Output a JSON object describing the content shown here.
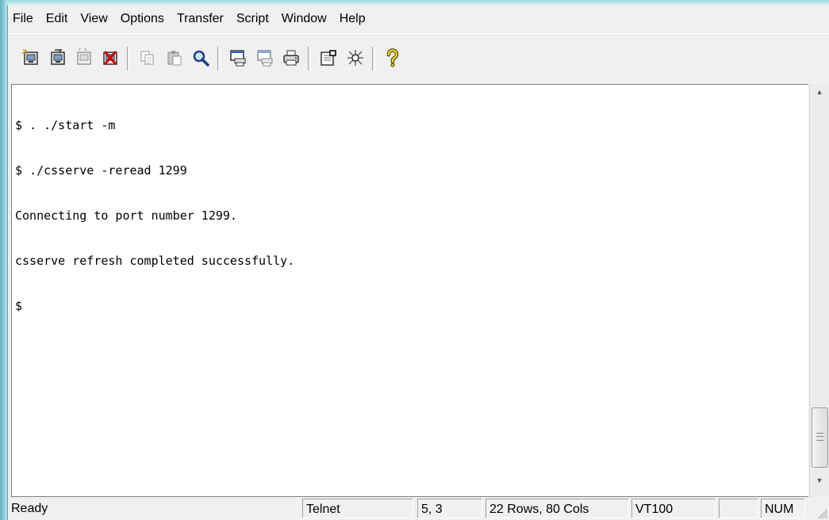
{
  "menu": {
    "items": [
      "File",
      "Edit",
      "View",
      "Options",
      "Transfer",
      "Script",
      "Window",
      "Help"
    ]
  },
  "toolbar": {
    "buttons": [
      "connect-icon",
      "quick-connect-icon",
      "reconnect-icon",
      "disconnect-icon",
      "copy-icon",
      "paste-icon",
      "find-icon",
      "print-screen-icon",
      "print-selection-icon",
      "print-icon",
      "session-options-icon",
      "keymap-icon",
      "help-icon"
    ]
  },
  "terminal": {
    "lines": [
      "$ . ./start -m",
      "$ ./csserve -reread 1299",
      "Connecting to port number 1299.",
      "csserve refresh completed successfully.",
      "$"
    ]
  },
  "statusbar": {
    "status": "Ready",
    "protocol": "Telnet",
    "cursor": "5,  3",
    "size": "22 Rows, 80 Cols",
    "emulation": "VT100",
    "cap": "",
    "num": "NUM"
  },
  "colors": {
    "accent": "#f5d400",
    "frame": "#8fd0dc"
  }
}
